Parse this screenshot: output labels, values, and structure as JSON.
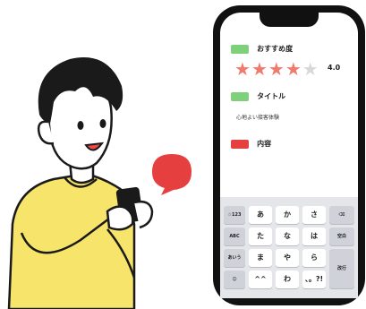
{
  "colors": {
    "accent_green": "#7fd07a",
    "accent_red": "#e63f3f",
    "star": "#f07a6e",
    "shirt": "#f7e46a"
  },
  "form": {
    "field1": {
      "badge_color": "#7fd07a",
      "label": "おすすめ度"
    },
    "rating": {
      "stars_filled": 4,
      "stars_total": 5,
      "value": "4.0"
    },
    "field2": {
      "badge_color": "#7fd07a",
      "label": "タイトル",
      "value": "心地よい接客体験"
    },
    "field3": {
      "badge_color": "#e63f3f",
      "label": "内容"
    }
  },
  "keyboard": {
    "keys": [
      "☆123",
      "あ",
      "か",
      "さ",
      "⌫",
      "ABC",
      "た",
      "な",
      "は",
      "空白",
      "あいう",
      "ま",
      "や",
      "ら",
      "改行",
      "☺",
      "^^",
      "わ",
      "、。?!"
    ]
  },
  "icons": {
    "speech_bubble": "speech-bubble-icon",
    "stars": "star-icon"
  }
}
